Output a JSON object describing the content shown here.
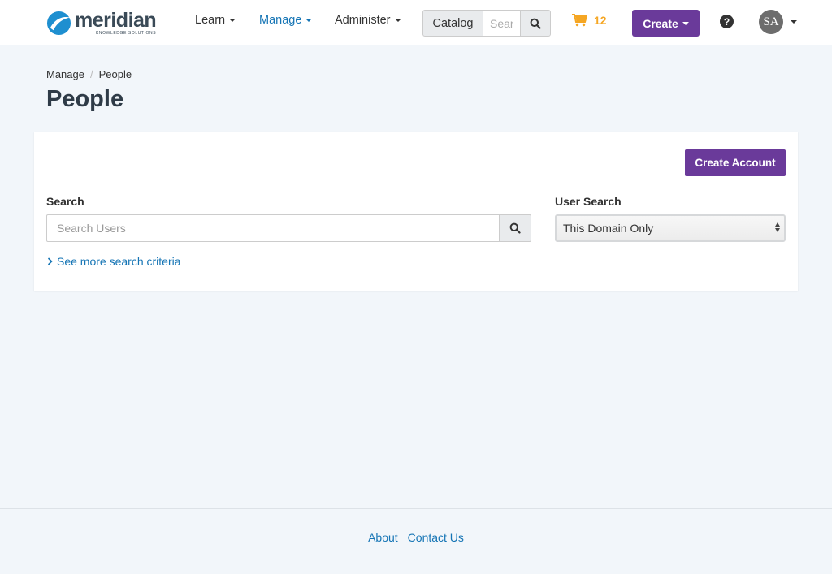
{
  "brand": {
    "name": "meridian",
    "tagline": "KNOWLEDGE SOLUTIONS",
    "color": "#1e8fd0"
  },
  "nav": {
    "items": [
      {
        "label": "Learn",
        "active": false
      },
      {
        "label": "Manage",
        "active": true
      },
      {
        "label": "Administer",
        "active": false
      }
    ]
  },
  "catalog": {
    "label": "Catalog",
    "placeholder": "Search"
  },
  "cart": {
    "count": "12",
    "icon": "cart-icon"
  },
  "header": {
    "create_label": "Create",
    "help_icon": "question-circle-icon",
    "user_initials": "SA"
  },
  "breadcrumb": {
    "items": [
      "Manage",
      "People"
    ]
  },
  "page": {
    "title": "People"
  },
  "panel": {
    "create_account_label": "Create Account",
    "search_label": "Search",
    "search_placeholder": "Search Users",
    "user_search_label": "User Search",
    "user_search_value": "This Domain Only",
    "more_criteria_label": "See more search criteria"
  },
  "footer": {
    "links": [
      "About",
      "Contact Us"
    ]
  },
  "colors": {
    "accent": "#1675b5",
    "primary_button": "#6a3a9a",
    "cart": "#f5a623",
    "background": "#f2f6fa"
  }
}
